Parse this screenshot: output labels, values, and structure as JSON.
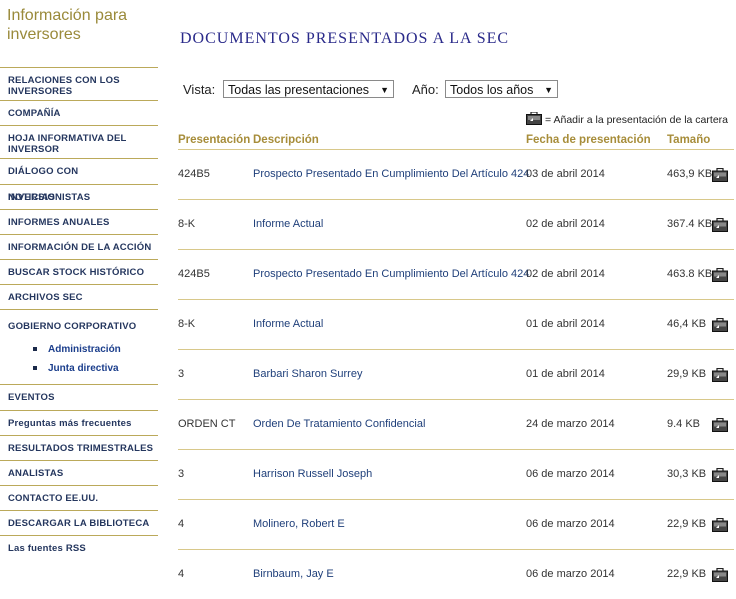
{
  "sidebar": {
    "title": "Información para inversores",
    "nav": [
      {
        "label": "RELACIONES CON LOS INVERSORES"
      },
      {
        "label": "COMPAÑÍA"
      },
      {
        "label": "HOJA INFORMATIVA DEL INVERSOR"
      },
      {
        "label": "DIÁLOGO CON INVERSIONISTAS"
      },
      {
        "label": "NOTICIAS"
      },
      {
        "label": "INFORMES ANUALES"
      },
      {
        "label": "INFORMACIÓN DE LA ACCIÓN"
      },
      {
        "label": "BUSCAR STOCK HISTÓRICO"
      },
      {
        "label": "ARCHIVOS SEC"
      },
      {
        "label": "GOBIERNO CORPORATIVO"
      },
      {
        "label": "EVENTOS"
      },
      {
        "label": "Preguntas más frecuentes"
      },
      {
        "label": "RESULTADOS TRIMESTRALES"
      },
      {
        "label": "ANALISTAS"
      },
      {
        "label": "CONTACTO EE.UU."
      },
      {
        "label": "DESCARGAR LA BIBLIOTECA"
      },
      {
        "label": "Las fuentes RSS"
      }
    ],
    "sub_items": [
      "Administración",
      "Junta directiva"
    ]
  },
  "main": {
    "title": "DOCUMENTOS PRESENTADOS A LA SEC",
    "view_label": "Vista:",
    "view_value": "Todas las presentaciones",
    "year_label": "Año:",
    "year_value": "Todos los años",
    "legend_text": "= Añadir a la presentación de la cartera",
    "icons": {
      "add_to_portfolio": "briefcase-add-icon"
    },
    "colors": {
      "accent": "#a78d3a",
      "link": "#1f3f7a",
      "rule": "#d8c88a"
    }
  },
  "table": {
    "headers": {
      "presentacion": "Presentación",
      "descripcion": "Descripción",
      "fecha": "Fecha de presentación",
      "tamano": "Tamaño"
    },
    "rows": [
      {
        "form": "424B5",
        "description": "Prospecto Presentado En Cumplimiento Del Artículo 424",
        "date": "03 de abril 2014",
        "size": "463,9 KB"
      },
      {
        "form": "8-K",
        "description": "Informe Actual",
        "date": "02 de abril 2014",
        "size": "367.4 KB"
      },
      {
        "form": "424B5",
        "description": "Prospecto Presentado En Cumplimiento Del Artículo 424",
        "date": "02 de abril 2014",
        "size": "463.8 KB"
      },
      {
        "form": "8-K",
        "description": "Informe Actual",
        "date": "01 de abril 2014",
        "size": "46,4 KB"
      },
      {
        "form": "3",
        "description": "Barbari Sharon Surrey",
        "date": "01 de abril 2014",
        "size": "29,9 KB"
      },
      {
        "form": "ORDEN CT",
        "description": "Orden De Tratamiento Confidencial",
        "date": "24 de marzo 2014",
        "size": "9.4 KB"
      },
      {
        "form": "3",
        "description": "Harrison Russell Joseph",
        "date": "06 de marzo 2014",
        "size": "30,3 KB"
      },
      {
        "form": "4",
        "description": "Molinero, Robert E",
        "date": "06 de marzo 2014",
        "size": "22,9 KB"
      },
      {
        "form": "4",
        "description": "Birnbaum, Jay E",
        "date": "06 de marzo 2014",
        "size": "22,9 KB"
      }
    ]
  }
}
